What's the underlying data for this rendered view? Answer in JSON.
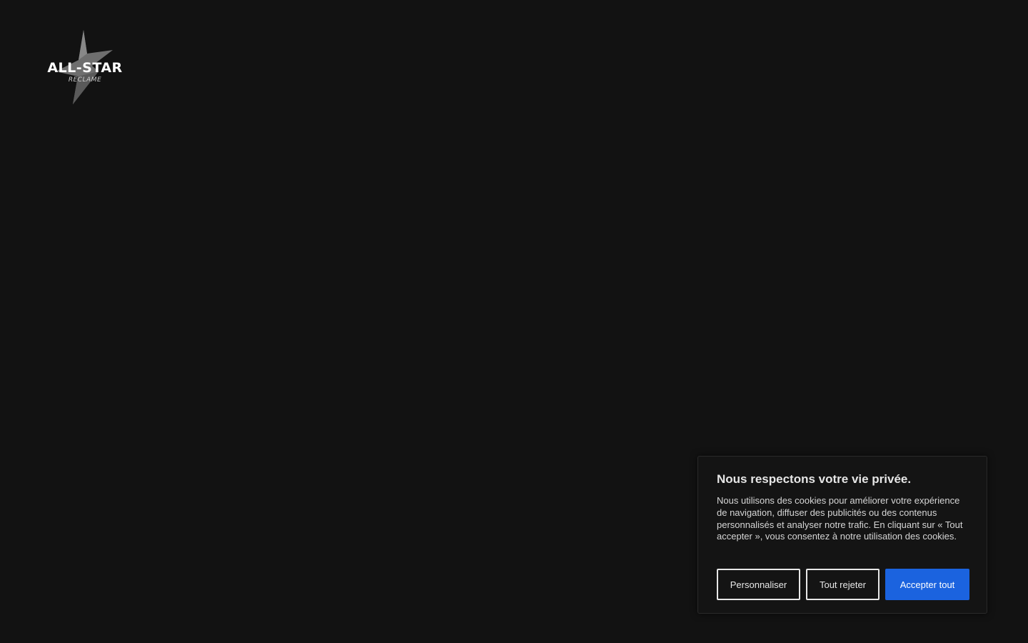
{
  "logo": {
    "icon": "star-icon",
    "title": "ALL-STAR",
    "subtitle": "RECLAME"
  },
  "cookie_banner": {
    "title": "Nous respectons votre vie privée.",
    "text": "Nous utilisons des cookies pour améliorer votre expérience de navigation, diffuser des publicités ou des contenus personnalisés et analyser notre trafic. En cliquant sur « Tout accepter », vous consentez à notre utilisation des cookies.",
    "buttons": {
      "customize": "Personnaliser",
      "reject": "Tout rejeter",
      "accept": "Accepter tout"
    }
  },
  "colors": {
    "background": "#121212",
    "accent": "#1b63df",
    "banner_background": "#141414"
  }
}
